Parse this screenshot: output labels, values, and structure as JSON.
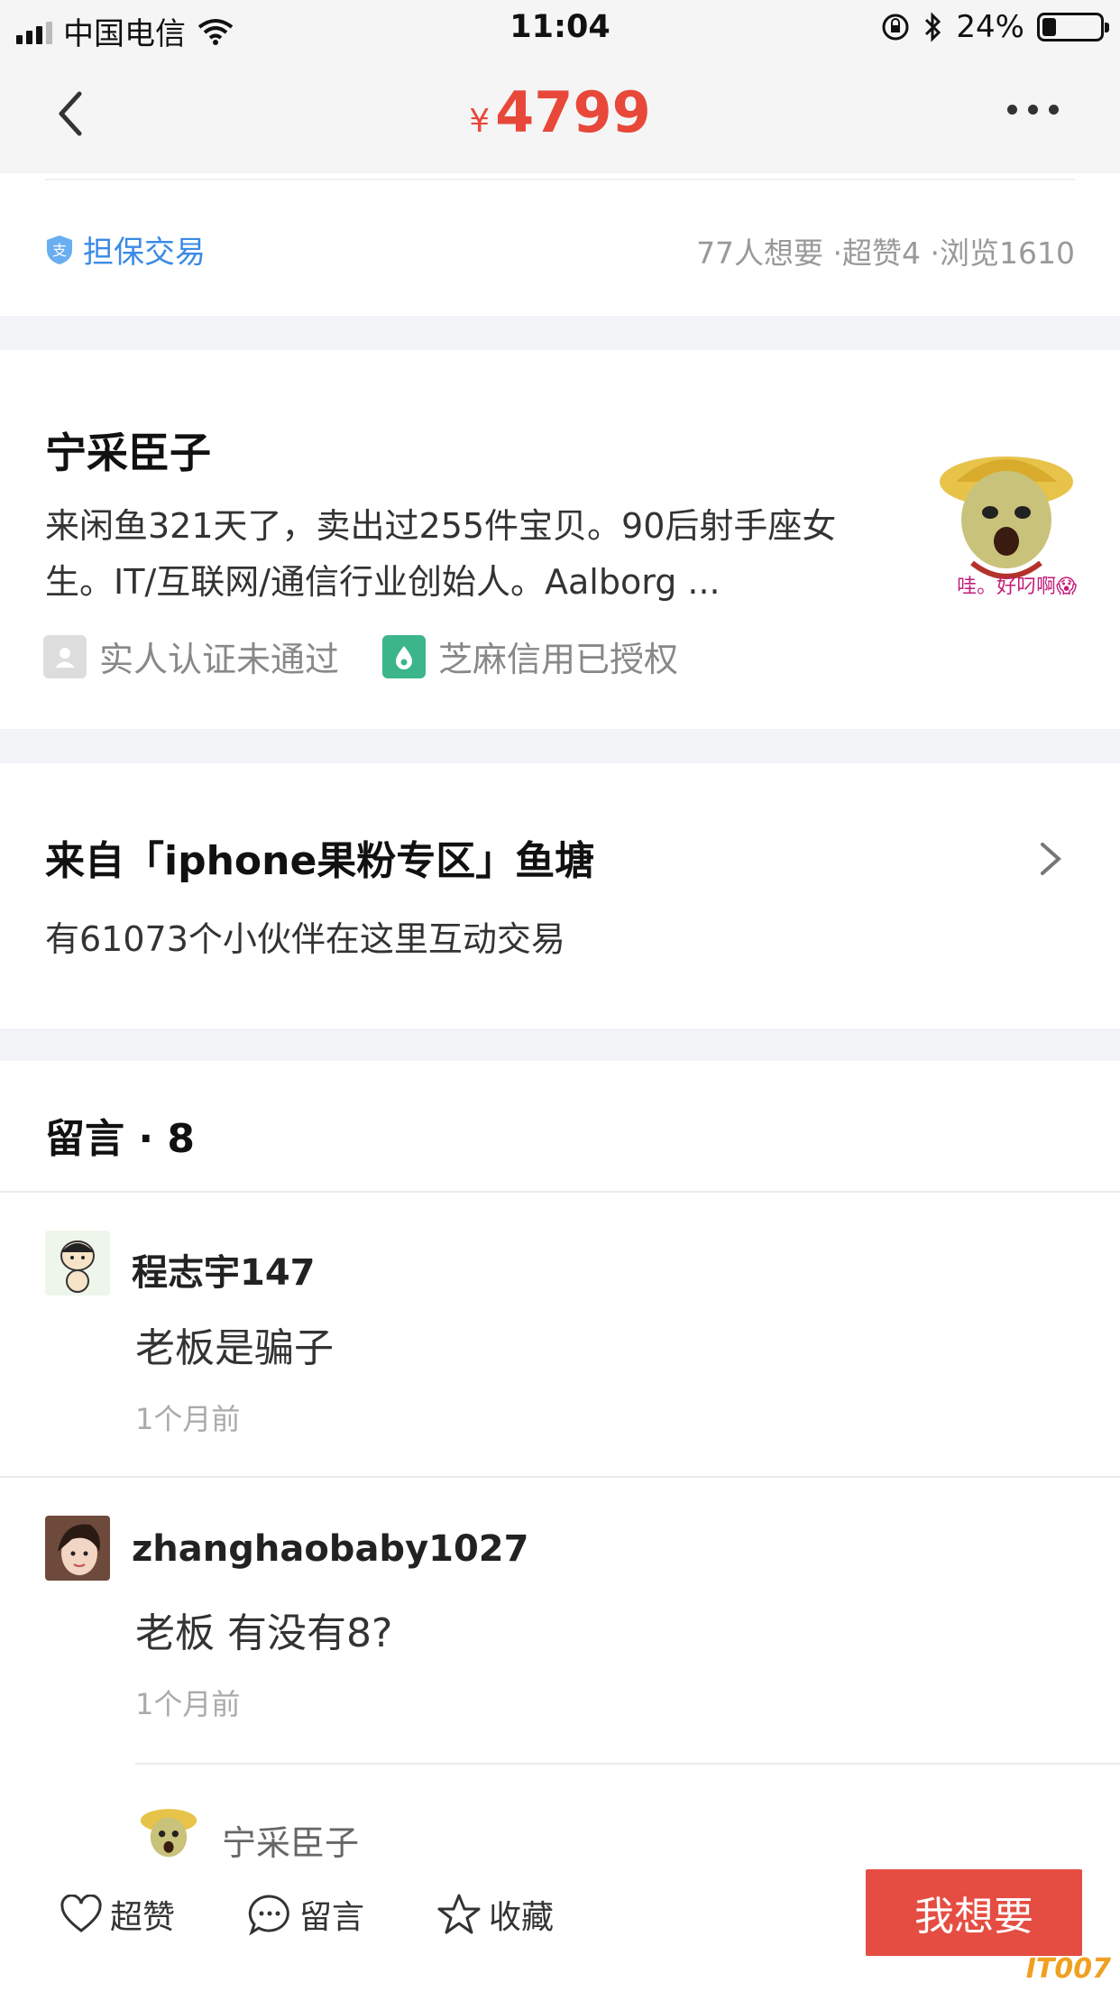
{
  "status_bar": {
    "carrier": "中国电信",
    "time": "11:04",
    "battery": "24%",
    "battery_level": 0.24
  },
  "nav": {
    "currency": "¥",
    "price": "4799"
  },
  "item": {
    "guarantee": "担保交易",
    "stats": "77人想要 ·超赞4 ·浏览1610"
  },
  "seller": {
    "name": "宁采臣子",
    "bio": "来闲鱼321天了，卖出过255件宝贝。90后射手座女生。IT/互联网/通信行业创始人。Aalborg ...",
    "avatar_caption": "哇。好叼啊😱",
    "badges": [
      "实人认证未通过",
      "芝麻信用已授权"
    ]
  },
  "pond": {
    "title": "来自「iphone果粉专区」鱼塘",
    "subtitle": "有61073个小伙伴在这里互动交易"
  },
  "comments": {
    "title": "留言 · 8",
    "items": [
      {
        "user": "程志宇147",
        "text": "老板是骗子",
        "time": "1个月前"
      },
      {
        "user": "zhanghaobaby1027",
        "text": "老板 有没有8?",
        "time": "1个月前"
      }
    ],
    "reply_user": "宁采臣子"
  },
  "bottom_bar": {
    "like": "超赞",
    "comment": "留言",
    "favorite": "收藏",
    "want": "我想要",
    "watermark": "IT007"
  }
}
